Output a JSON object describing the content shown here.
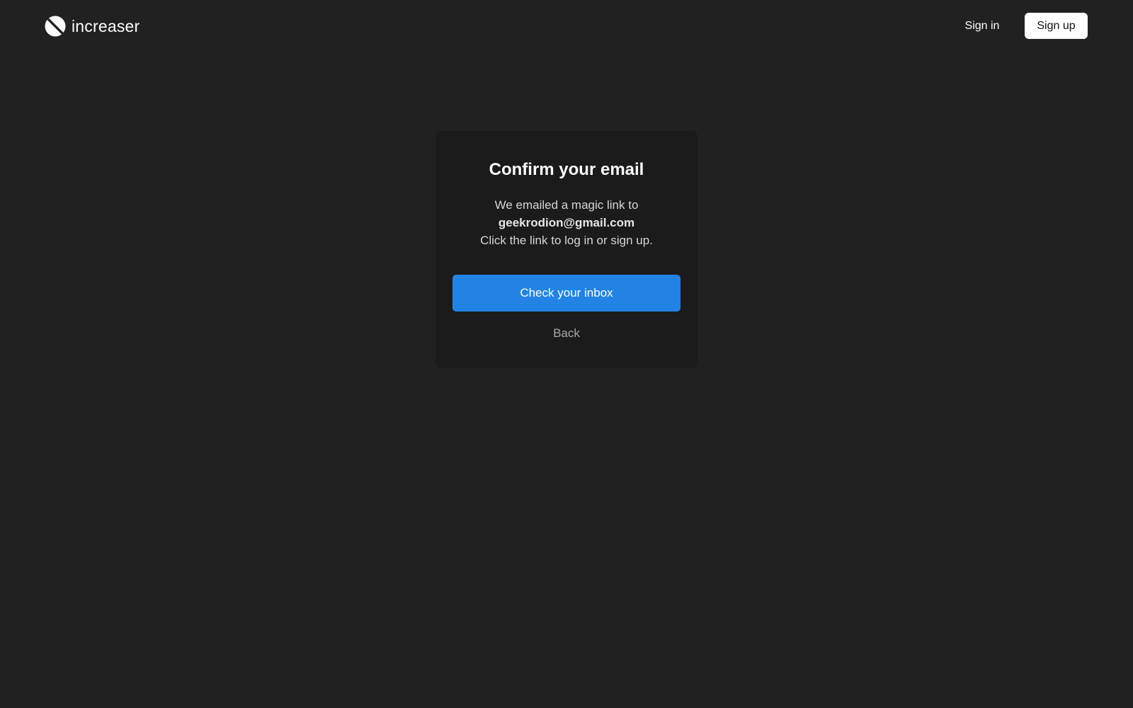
{
  "header": {
    "logo_icon": "increaser-logo-icon",
    "logo_text": "increaser",
    "signin_label": "Sign in",
    "signup_label": "Sign up"
  },
  "confirm_card": {
    "title": "Confirm your email",
    "message_line1": "We emailed a magic link to",
    "email": "geekrodion@gmail.com",
    "message_line2": "Click the link to log in or sign up.",
    "primary_button_label": "Check your inbox",
    "back_label": "Back"
  },
  "colors": {
    "background": "#212121",
    "card": "#1b1b1b",
    "primary": "#2283e5",
    "text": "#ffffff",
    "muted": "#a8a8a8"
  }
}
